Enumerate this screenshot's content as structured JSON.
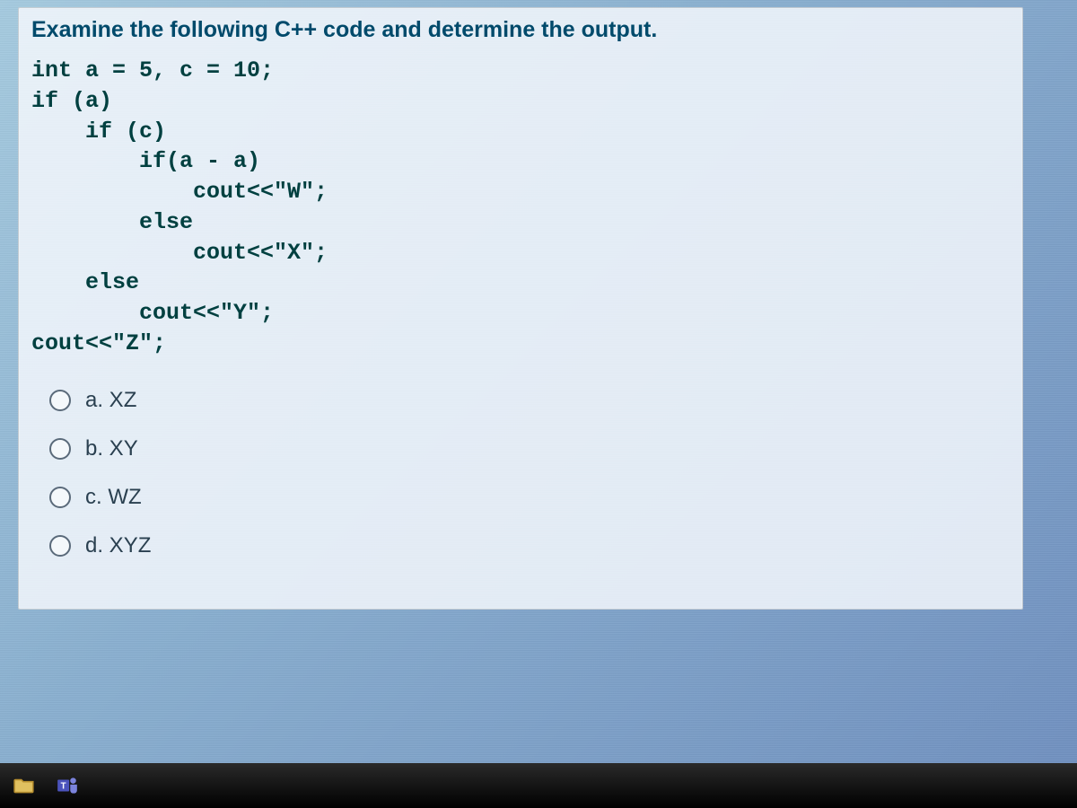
{
  "question": {
    "prompt": "Examine the following C++ code and determine the output.",
    "code": "int a = 5, c = 10;\nif (a)\n    if (c)\n        if(a - a)\n            cout<<\"W\";\n        else\n            cout<<\"X\";\n    else\n        cout<<\"Y\";\ncout<<\"Z\";",
    "options": [
      {
        "key": "a",
        "label": "a. XZ"
      },
      {
        "key": "b",
        "label": "b. XY"
      },
      {
        "key": "c",
        "label": "c. WZ"
      },
      {
        "key": "d",
        "label": "d. XYZ"
      }
    ]
  },
  "taskbar": {
    "icons": [
      {
        "name": "file-explorer-icon"
      },
      {
        "name": "teams-icon"
      }
    ]
  }
}
